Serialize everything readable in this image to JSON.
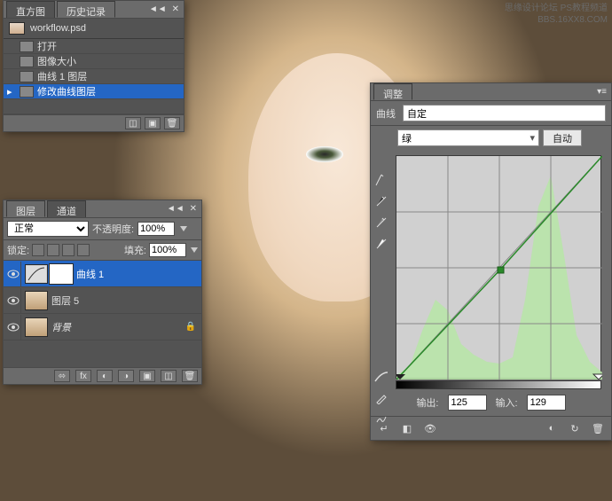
{
  "watermark": {
    "line1": "思缘设计论坛  PS教程频道",
    "line2": "BBS.16XX8.COM"
  },
  "history_panel": {
    "tabs": [
      "直方图",
      "历史记录"
    ],
    "file_name": "workflow.psd",
    "states": [
      {
        "label": "打开",
        "selected": false
      },
      {
        "label": "图像大小",
        "selected": false
      },
      {
        "label": "曲线 1 图层",
        "selected": false
      },
      {
        "label": "修改曲线图层",
        "selected": true
      }
    ]
  },
  "layers_panel": {
    "tabs": [
      "图层",
      "通道"
    ],
    "blend_mode": "正常",
    "opacity_label": "不透明度:",
    "opacity": "100%",
    "lock_label": "锁定:",
    "fill_label": "填充:",
    "fill": "100%",
    "layers": [
      {
        "name": "曲线 1",
        "type": "adjustment",
        "selected": true,
        "visible": true
      },
      {
        "name": "图层 5",
        "type": "normal",
        "selected": false,
        "visible": true
      },
      {
        "name": "背景",
        "type": "background",
        "selected": false,
        "visible": true
      }
    ]
  },
  "adjust_panel": {
    "tab": "调整",
    "type_label": "曲线",
    "preset": "自定",
    "channel": "绿",
    "auto_btn": "自动",
    "output_label": "输出:",
    "output_value": "125",
    "input_label": "输入:",
    "input_value": "129"
  },
  "chart_data": {
    "type": "line",
    "title": "",
    "xlabel": "输入",
    "ylabel": "输出",
    "xlim": [
      0,
      255
    ],
    "ylim": [
      0,
      255
    ],
    "grid": true,
    "series": [
      {
        "name": "曲线",
        "x": [
          0,
          129,
          255
        ],
        "y": [
          0,
          125,
          255
        ]
      }
    ],
    "histogram": {
      "channel": "绿",
      "x": [
        0,
        16,
        32,
        48,
        64,
        80,
        96,
        112,
        128,
        144,
        160,
        176,
        192,
        208,
        224,
        240,
        255
      ],
      "y": [
        5,
        15,
        55,
        90,
        78,
        40,
        28,
        20,
        18,
        25,
        90,
        195,
        230,
        140,
        50,
        20,
        8
      ]
    },
    "control_point": {
      "input": 129,
      "output": 125
    }
  }
}
